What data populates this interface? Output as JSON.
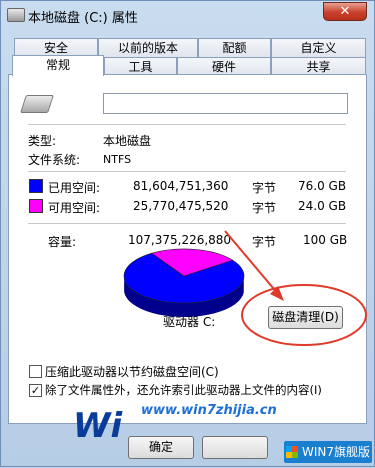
{
  "window": {
    "title": "本地磁盘 (C:) 属性",
    "close_label": "✕"
  },
  "tabs_row1": [
    "安全",
    "以前的版本",
    "配额",
    "自定义"
  ],
  "tabs_row2": [
    "常规",
    "工具",
    "硬件",
    "共享"
  ],
  "general": {
    "name_value": "",
    "type_label": "类型:",
    "type_value": "本地磁盘",
    "fs_label": "文件系统:",
    "fs_value": "NTFS",
    "used": {
      "label": "已用空间:",
      "bytes": "81,604,751,360",
      "unit": "字节",
      "size": "76.0 GB",
      "color": "#0000ff"
    },
    "free": {
      "label": "可用空间:",
      "bytes": "25,770,475,520",
      "unit": "字节",
      "size": "24.0 GB",
      "color": "#ff00ff"
    },
    "capacity": {
      "label": "容量:",
      "bytes": "107,375,226,880",
      "unit": "字节",
      "size": "100 GB"
    },
    "drive_label": "驱动器 C:",
    "cleanup_button": "磁盘清理(D)",
    "compress_label": "压缩此驱动器以节约磁盘空间(C)",
    "compress_checked": false,
    "index_label": "除了文件属性外，还允许索引此驱动器上文件的内容(I)",
    "index_checked": true
  },
  "chart_data": {
    "type": "pie",
    "values": [
      81604751360,
      25770475520
    ],
    "labels": [
      "已用空间",
      "可用空间"
    ],
    "colors": [
      "#0000ff",
      "#ff00ff"
    ]
  },
  "footer": {
    "ok_label": "确定"
  },
  "watermark": {
    "url": "www.win7zhijia.cn",
    "logo_text": "WIN7旗舰版",
    "brand_partial": "Wi"
  },
  "annotation_color": "#e03a2a"
}
